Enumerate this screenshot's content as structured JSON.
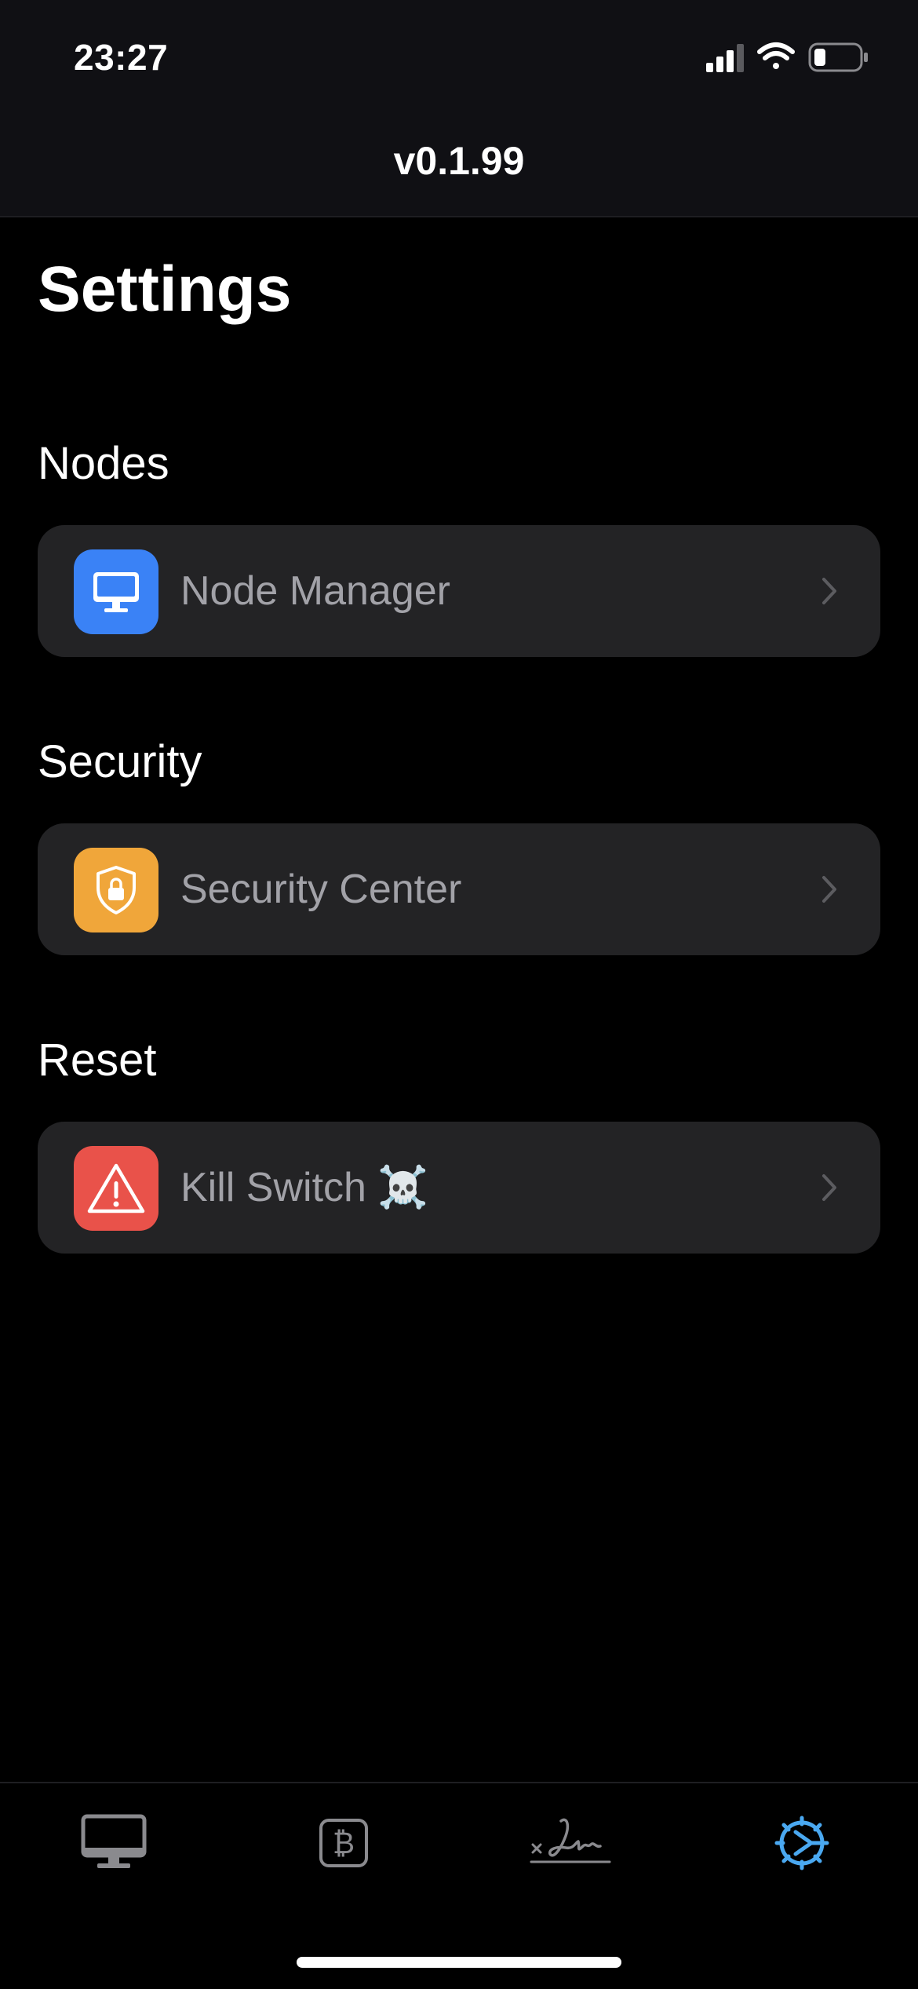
{
  "status_bar": {
    "time": "23:27",
    "icons": [
      "cellular-signal-icon",
      "wifi-icon",
      "battery-icon"
    ]
  },
  "nav": {
    "title": "v0.1.99"
  },
  "page": {
    "title": "Settings"
  },
  "sections": [
    {
      "header": "Nodes",
      "row": {
        "label": "Node Manager",
        "icon": "desktop-icon",
        "icon_color": "#3a82f6"
      }
    },
    {
      "header": "Security",
      "row": {
        "label": "Security Center",
        "icon": "shield-lock-icon",
        "icon_color": "#f0a63a"
      }
    },
    {
      "header": "Reset",
      "row": {
        "label": "Kill Switch ☠️",
        "icon": "warning-triangle-icon",
        "icon_color": "#e9524a"
      }
    }
  ],
  "tab_bar": {
    "tabs": [
      {
        "icon": "desktop-icon",
        "selected": false
      },
      {
        "icon": "bitcoin-icon",
        "selected": false
      },
      {
        "icon": "signature-icon",
        "selected": false
      },
      {
        "icon": "gear-icon",
        "selected": true
      }
    ],
    "selected_color": "#4aa8f0",
    "unselected_color": "#8a8a8e"
  }
}
